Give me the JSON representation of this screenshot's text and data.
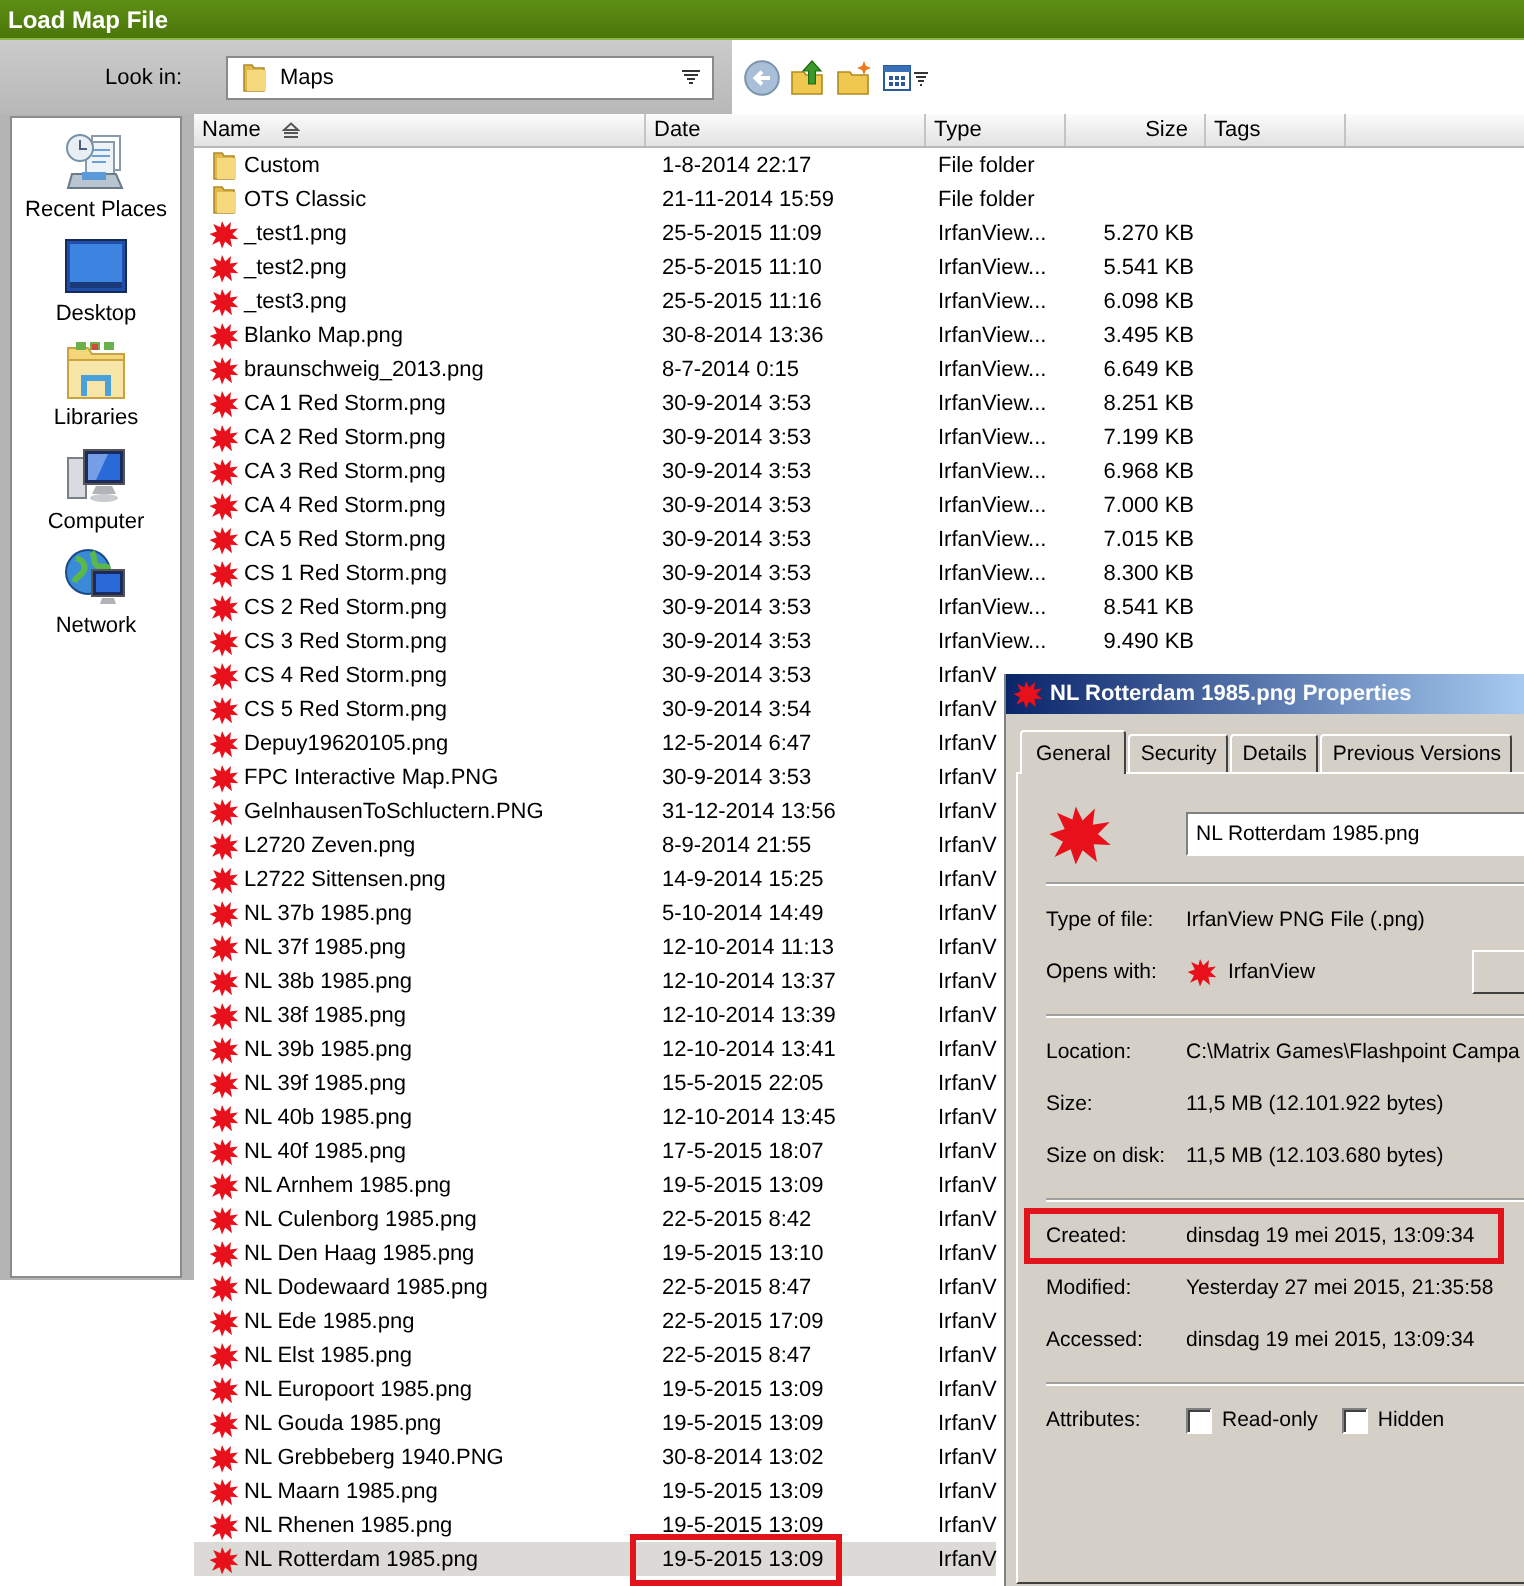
{
  "window": {
    "title": "Load Map File"
  },
  "toolbar": {
    "look_in_label": "Look in:",
    "location": "Maps"
  },
  "sidebar": {
    "items": [
      {
        "kind": "recent",
        "label": "Recent Places"
      },
      {
        "kind": "desktop",
        "label": "Desktop"
      },
      {
        "kind": "libraries",
        "label": "Libraries"
      },
      {
        "kind": "computer",
        "label": "Computer"
      },
      {
        "kind": "network",
        "label": "Network"
      }
    ]
  },
  "files": {
    "columns": [
      {
        "label": "Name",
        "sorted": true
      },
      {
        "label": "Date",
        "sorted": false
      },
      {
        "label": "Type",
        "sorted": false
      },
      {
        "label": "Size",
        "sorted": false
      },
      {
        "label": "Tags",
        "sorted": false
      }
    ],
    "rows": [
      {
        "kind": "folder",
        "name": "Custom",
        "date": "1-8-2014 22:17",
        "type": "File folder",
        "selected": false
      },
      {
        "kind": "folder",
        "name": "OTS Classic",
        "date": "21-11-2014 15:59",
        "type": "File folder",
        "selected": false
      },
      {
        "kind": "image",
        "name": "_test1.png",
        "date": "25-5-2015 11:09",
        "type": "IrfanView...",
        "size": "5.270 KB",
        "selected": false
      },
      {
        "kind": "image",
        "name": "_test2.png",
        "date": "25-5-2015 11:10",
        "type": "IrfanView...",
        "size": "5.541 KB",
        "selected": false
      },
      {
        "kind": "image",
        "name": "_test3.png",
        "date": "25-5-2015 11:16",
        "type": "IrfanView...",
        "size": "6.098 KB",
        "selected": false
      },
      {
        "kind": "image",
        "name": "Blanko Map.png",
        "date": "30-8-2014 13:36",
        "type": "IrfanView...",
        "size": "3.495 KB",
        "selected": false
      },
      {
        "kind": "image",
        "name": "braunschweig_2013.png",
        "date": "8-7-2014 0:15",
        "type": "IrfanView...",
        "size": "6.649 KB",
        "selected": false
      },
      {
        "kind": "image",
        "name": "CA 1 Red Storm.png",
        "date": "30-9-2014 3:53",
        "type": "IrfanView...",
        "size": "8.251 KB",
        "selected": false
      },
      {
        "kind": "image",
        "name": "CA 2 Red Storm.png",
        "date": "30-9-2014 3:53",
        "type": "IrfanView...",
        "size": "7.199 KB",
        "selected": false
      },
      {
        "kind": "image",
        "name": "CA 3 Red Storm.png",
        "date": "30-9-2014 3:53",
        "type": "IrfanView...",
        "size": "6.968 KB",
        "selected": false
      },
      {
        "kind": "image",
        "name": "CA 4 Red Storm.png",
        "date": "30-9-2014 3:53",
        "type": "IrfanView...",
        "size": "7.000 KB",
        "selected": false
      },
      {
        "kind": "image",
        "name": "CA 5 Red Storm.png",
        "date": "30-9-2014 3:53",
        "type": "IrfanView...",
        "size": "7.015 KB",
        "selected": false
      },
      {
        "kind": "image",
        "name": "CS 1 Red Storm.png",
        "date": "30-9-2014 3:53",
        "type": "IrfanView...",
        "size": "8.300 KB",
        "selected": false
      },
      {
        "kind": "image",
        "name": "CS 2 Red Storm.png",
        "date": "30-9-2014 3:53",
        "type": "IrfanView...",
        "size": "8.541 KB",
        "selected": false
      },
      {
        "kind": "image",
        "name": "CS 3 Red Storm.png",
        "date": "30-9-2014 3:53",
        "type": "IrfanView...",
        "size": "9.490 KB",
        "selected": false
      },
      {
        "kind": "image",
        "name": "CS 4 Red Storm.png",
        "date": "30-9-2014 3:53",
        "type": "IrfanV",
        "selected": false
      },
      {
        "kind": "image",
        "name": "CS 5 Red Storm.png",
        "date": "30-9-2014 3:54",
        "type": "IrfanV",
        "selected": false
      },
      {
        "kind": "image",
        "name": "Depuy19620105.png",
        "date": "12-5-2014 6:47",
        "type": "IrfanV",
        "selected": false
      },
      {
        "kind": "image",
        "name": "FPC Interactive Map.PNG",
        "date": "30-9-2014 3:53",
        "type": "IrfanV",
        "selected": false
      },
      {
        "kind": "image",
        "name": "GelnhausenToSchluctern.PNG",
        "date": "31-12-2014 13:56",
        "type": "IrfanV",
        "selected": false
      },
      {
        "kind": "image",
        "name": "L2720 Zeven.png",
        "date": "8-9-2014 21:55",
        "type": "IrfanV",
        "selected": false
      },
      {
        "kind": "image",
        "name": "L2722 Sittensen.png",
        "date": "14-9-2014 15:25",
        "type": "IrfanV",
        "selected": false
      },
      {
        "kind": "image",
        "name": "NL 37b 1985.png",
        "date": "5-10-2014 14:49",
        "type": "IrfanV",
        "selected": false
      },
      {
        "kind": "image",
        "name": "NL 37f 1985.png",
        "date": "12-10-2014 11:13",
        "type": "IrfanV",
        "selected": false
      },
      {
        "kind": "image",
        "name": "NL 38b 1985.png",
        "date": "12-10-2014 13:37",
        "type": "IrfanV",
        "selected": false
      },
      {
        "kind": "image",
        "name": "NL 38f 1985.png",
        "date": "12-10-2014 13:39",
        "type": "IrfanV",
        "selected": false
      },
      {
        "kind": "image",
        "name": "NL 39b 1985.png",
        "date": "12-10-2014 13:41",
        "type": "IrfanV",
        "selected": false
      },
      {
        "kind": "image",
        "name": "NL 39f 1985.png",
        "date": "15-5-2015 22:05",
        "type": "IrfanV",
        "selected": false
      },
      {
        "kind": "image",
        "name": "NL 40b 1985.png",
        "date": "12-10-2014 13:45",
        "type": "IrfanV",
        "selected": false
      },
      {
        "kind": "image",
        "name": "NL 40f 1985.png",
        "date": "17-5-2015 18:07",
        "type": "IrfanV",
        "selected": false
      },
      {
        "kind": "image",
        "name": "NL Arnhem 1985.png",
        "date": "19-5-2015 13:09",
        "type": "IrfanV",
        "selected": false
      },
      {
        "kind": "image",
        "name": "NL Culenborg 1985.png",
        "date": "22-5-2015 8:42",
        "type": "IrfanV",
        "selected": false
      },
      {
        "kind": "image",
        "name": "NL Den Haag 1985.png",
        "date": "19-5-2015 13:10",
        "type": "IrfanV",
        "selected": false
      },
      {
        "kind": "image",
        "name": "NL Dodewaard 1985.png",
        "date": "22-5-2015 8:47",
        "type": "IrfanV",
        "selected": false
      },
      {
        "kind": "image",
        "name": "NL Ede 1985.png",
        "date": "22-5-2015 17:09",
        "type": "IrfanV",
        "selected": false
      },
      {
        "kind": "image",
        "name": "NL Elst 1985.png",
        "date": "22-5-2015 8:47",
        "type": "IrfanV",
        "selected": false
      },
      {
        "kind": "image",
        "name": "NL Europoort 1985.png",
        "date": "19-5-2015 13:09",
        "type": "IrfanV",
        "selected": false
      },
      {
        "kind": "image",
        "name": "NL Gouda 1985.png",
        "date": "19-5-2015 13:09",
        "type": "IrfanV",
        "selected": false
      },
      {
        "kind": "image",
        "name": "NL Grebbeberg 1940.PNG",
        "date": "30-8-2014 13:02",
        "type": "IrfanV",
        "selected": false
      },
      {
        "kind": "image",
        "name": "NL Maarn 1985.png",
        "date": "19-5-2015 13:09",
        "type": "IrfanV",
        "selected": false
      },
      {
        "kind": "image",
        "name": "NL Rhenen 1985.png",
        "date": "19-5-2015 13:09",
        "type": "IrfanV",
        "selected": false
      },
      {
        "kind": "image",
        "name": "NL Rotterdam 1985.png",
        "date": "19-5-2015 13:09",
        "type": "IrfanV",
        "selected": true,
        "marked": true
      }
    ]
  },
  "properties": {
    "title": "NL Rotterdam 1985.png Properties",
    "tabs": [
      {
        "label": "General",
        "selected": true
      },
      {
        "label": "Security",
        "selected": false
      },
      {
        "label": "Details",
        "selected": false
      },
      {
        "label": "Previous Versions",
        "selected": false
      }
    ],
    "file_name": "NL Rotterdam 1985.png",
    "sections": [
      [
        {
          "kind": "text",
          "label": "Type of file:",
          "value": "IrfanView PNG File (.png)"
        },
        {
          "kind": "app",
          "label": "Opens with:",
          "value": "IrfanView"
        }
      ],
      [
        {
          "kind": "text",
          "label": "Location:",
          "value": "C:\\Matrix Games\\Flashpoint Campa"
        },
        {
          "kind": "text",
          "label": "Size:",
          "value": "11,5 MB (12.101.922 bytes)"
        },
        {
          "kind": "text",
          "label": "Size on disk:",
          "value": "11,5 MB (12.103.680 bytes)"
        }
      ],
      [
        {
          "kind": "text",
          "label": "Created:",
          "value": "dinsdag 19 mei 2015, 13:09:34",
          "marked": true
        },
        {
          "kind": "text",
          "label": "Modified:",
          "value": "Yesterday 27 mei 2015, 21:35:58"
        },
        {
          "kind": "text",
          "label": "Accessed:",
          "value": "dinsdag 19 mei 2015, 13:09:34"
        }
      ]
    ],
    "attributes": {
      "label": "Attributes:",
      "options": [
        {
          "label": "Read-only",
          "checked": false
        },
        {
          "label": "Hidden",
          "checked": false
        }
      ]
    }
  }
}
